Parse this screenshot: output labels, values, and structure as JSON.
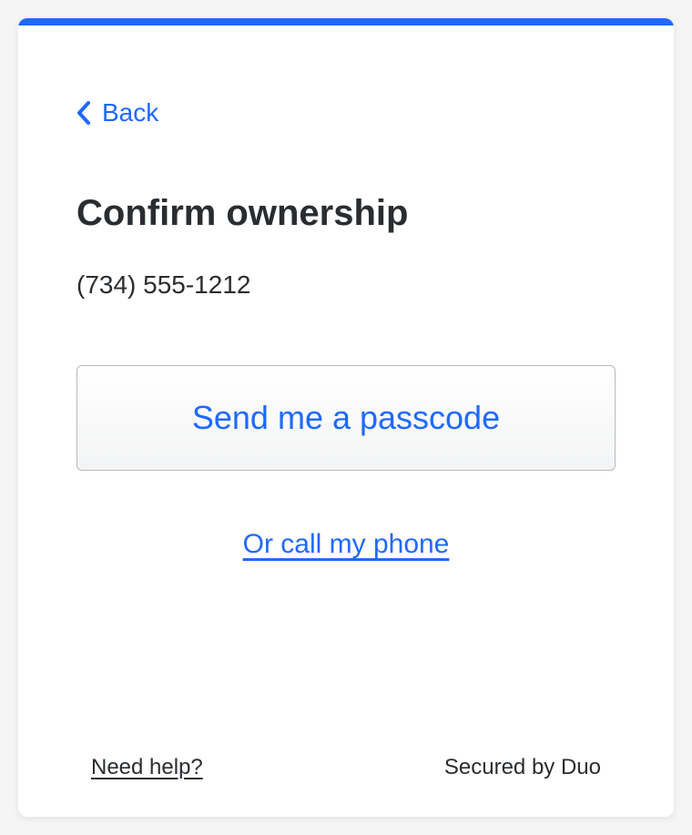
{
  "colors": {
    "accent": "#1f69ff",
    "text": "#2a2d30"
  },
  "nav": {
    "back_label": "Back"
  },
  "main": {
    "title": "Confirm ownership",
    "phone_number": "(734) 555-1212",
    "primary_button_label": "Send me a passcode",
    "alt_link_label": "Or call my phone"
  },
  "footer": {
    "help_label": "Need help?",
    "secured_label": "Secured by Duo"
  }
}
